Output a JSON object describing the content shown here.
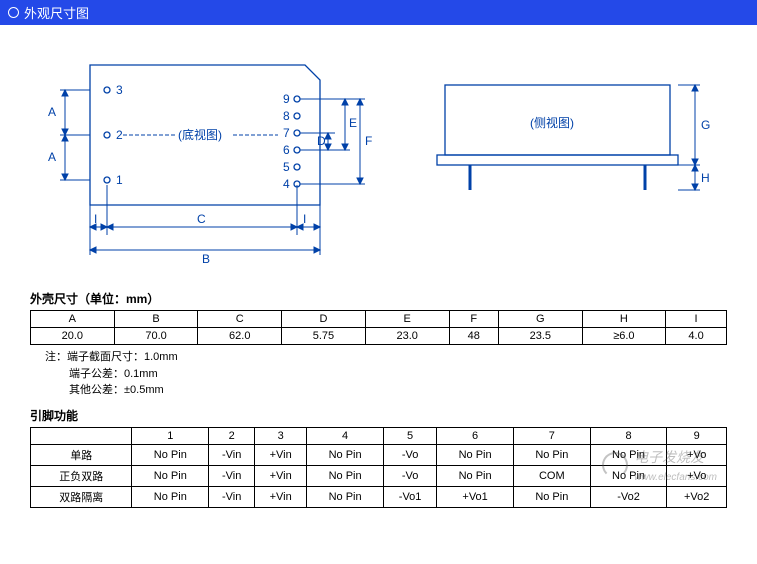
{
  "header": {
    "title": "外观尺寸图"
  },
  "diagram": {
    "bottom_view_label": "(底视图)",
    "side_view_label": "(侧视图)",
    "pins_left": [
      "3",
      "2",
      "1"
    ],
    "pins_right": [
      "9",
      "8",
      "7",
      "6",
      "5",
      "4"
    ],
    "dim_labels": {
      "A": "A",
      "B": "B",
      "C": "C",
      "D": "D",
      "E": "E",
      "F": "F",
      "G": "G",
      "H": "H",
      "I": "I"
    }
  },
  "dims_section": {
    "title": "外壳尺寸（单位：mm）",
    "headers": [
      "A",
      "B",
      "C",
      "D",
      "E",
      "F",
      "G",
      "H",
      "I"
    ],
    "values": [
      "20.0",
      "70.0",
      "62.0",
      "5.75",
      "23.0",
      "48",
      "23.5",
      "≥6.0",
      "4.0"
    ],
    "note1": "注：端子截面尺寸：1.0mm",
    "note2": "端子公差：0.1mm",
    "note3": "其他公差：±0.5mm"
  },
  "pins_section": {
    "title": "引脚功能",
    "headers": [
      "",
      "1",
      "2",
      "3",
      "4",
      "5",
      "6",
      "7",
      "8",
      "9"
    ],
    "rows": [
      {
        "label": "单路",
        "cells": [
          "No Pin",
          "-Vin",
          "+Vin",
          "No Pin",
          "-Vo",
          "No Pin",
          "No Pin",
          "No Pin",
          "+Vo"
        ]
      },
      {
        "label": "正负双路",
        "cells": [
          "No Pin",
          "-Vin",
          "+Vin",
          "No Pin",
          "-Vo",
          "No Pin",
          "COM",
          "No Pin",
          "+Vo"
        ]
      },
      {
        "label": "双路隔离",
        "cells": [
          "No Pin",
          "-Vin",
          "+Vin",
          "No Pin",
          "-Vo1",
          "+Vo1",
          "No Pin",
          "-Vo2",
          "+Vo2"
        ]
      }
    ]
  },
  "watermark": {
    "text": "电子发烧友",
    "url": "www.elecfans.com"
  }
}
